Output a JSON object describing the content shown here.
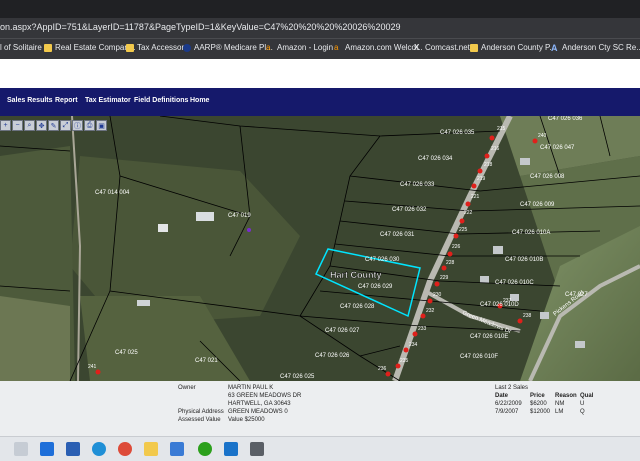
{
  "browser": {
    "url": "on.aspx?AppID=751&LayerID=11787&PageTypeID=1&KeyValue=C47%20%20%20%20026%20029"
  },
  "bookmarks": [
    {
      "label": "l of Solitaire",
      "icon": "solitaire-icon"
    },
    {
      "label": "Real Estate Compan...",
      "icon": "folder-icon"
    },
    {
      "label": "Tax Accessors",
      "icon": "folder-icon"
    },
    {
      "label": "AARP® Medicare Pl...",
      "icon": "aarp-icon"
    },
    {
      "label": "Amazon - Login",
      "icon": "amazon-icon"
    },
    {
      "label": "Amazon.com Welco...",
      "icon": "amazon-icon"
    },
    {
      "label": "Comcast.net",
      "icon": "comcast-icon"
    },
    {
      "label": "Anderson County P...",
      "icon": "folder-icon"
    },
    {
      "label": "Anderson Cty SC Re...",
      "icon": "anderson-icon"
    }
  ],
  "nav": {
    "items": [
      "Sales Results",
      "Report",
      "Tax Estimator",
      "Field Definitions",
      "Home"
    ]
  },
  "map": {
    "county_label": "Hart County",
    "parcels": [
      "C47 026 035",
      "C47 026 036",
      "C47 026 034",
      "C47 026 033",
      "C47 026 032",
      "C47 026 031",
      "C47 026 030",
      "C47 026 029",
      "C47 026 028",
      "C47 026 027",
      "C47 026 026",
      "C47 026 025",
      "C47 019",
      "C47 014 004",
      "C47 025",
      "C47 021",
      "C47 026 047",
      "C47 026 008",
      "C47 026 009",
      "C47 026 010A",
      "C47 026 010B",
      "C47 026 010C",
      "C47 026 010D",
      "C47 026 010E",
      "C47 026 010F",
      "C47 027"
    ],
    "street_label": "Green Meadows Dr",
    "road_label": "Pickens Road",
    "markers": [
      "215",
      "216",
      "218",
      "219",
      "221",
      "222",
      "225",
      "226",
      "228",
      "229",
      "230",
      "232",
      "233",
      "234",
      "235",
      "236",
      "237",
      "238",
      "240",
      "241"
    ]
  },
  "owner": {
    "owner_label": "Owner",
    "owner_name": "MARTIN PAUL K",
    "address1": "63 GREEN MEADOWS DR",
    "address2": "HARTWELL, GA 30643",
    "physical_label": "Physical Address",
    "physical_value": "GREEN MEADOWS 0",
    "assessed_label": "Assessed Value",
    "assessed_value": "Value $25000"
  },
  "sales": {
    "title": "Last 2 Sales",
    "headers": [
      "Date",
      "Price",
      "Reason",
      "Qual"
    ],
    "rows": [
      [
        "6/22/2009",
        "$6200",
        "NM",
        "U"
      ],
      [
        "7/9/2007",
        "$12000",
        "LM",
        "Q"
      ]
    ]
  },
  "colors": {
    "nav_bg": "#15196b",
    "parcel_line": "#000000",
    "highlight": "#00e5ff",
    "marker": "#e0201b"
  }
}
